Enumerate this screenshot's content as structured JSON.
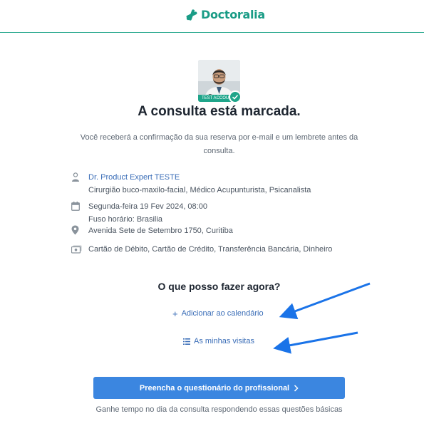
{
  "brand": {
    "name": "Doctoralia",
    "color": "#1a9c86"
  },
  "avatar": {
    "badge": "TEST ACCOUNT"
  },
  "title": "A consulta está marcada.",
  "subtitle": "Você receberá a confirmação da sua reserva por e-mail e um lembrete antes da consulta.",
  "details": {
    "doctor_name": "Dr. Product Expert TESTE",
    "specialties": "Cirurgião buco-maxilo-facial, Médico Acupunturista, Psicanalista",
    "date": "Segunda-feira 19 Fev 2024, 08:00",
    "timezone": "Fuso horário: Brasilia",
    "address": "Avenida Sete de Setembro 1750, Curitiba",
    "payment": "Cartão de Débito, Cartão de Crédito, Transferência Bancária, Dinheiro"
  },
  "next": {
    "title": "O que posso fazer agora?",
    "add_calendar": "Adicionar ao calendário",
    "my_visits": "As minhas visitas"
  },
  "cta": {
    "label": "Preencha o questionário do profissional"
  },
  "footnote": "Ganhe tempo no dia da consulta respondendo essas questões básicas",
  "colors": {
    "accent": "#1fa58a",
    "link": "#3a6db7",
    "button": "#3b86e0",
    "annotation_arrow": "#1a73e8"
  },
  "icons": [
    "doctoralia-logo-icon",
    "doctor-icon",
    "calendar-icon",
    "location-pin-icon",
    "payment-icon",
    "plus-icon",
    "list-icon",
    "chevron-right-icon"
  ]
}
